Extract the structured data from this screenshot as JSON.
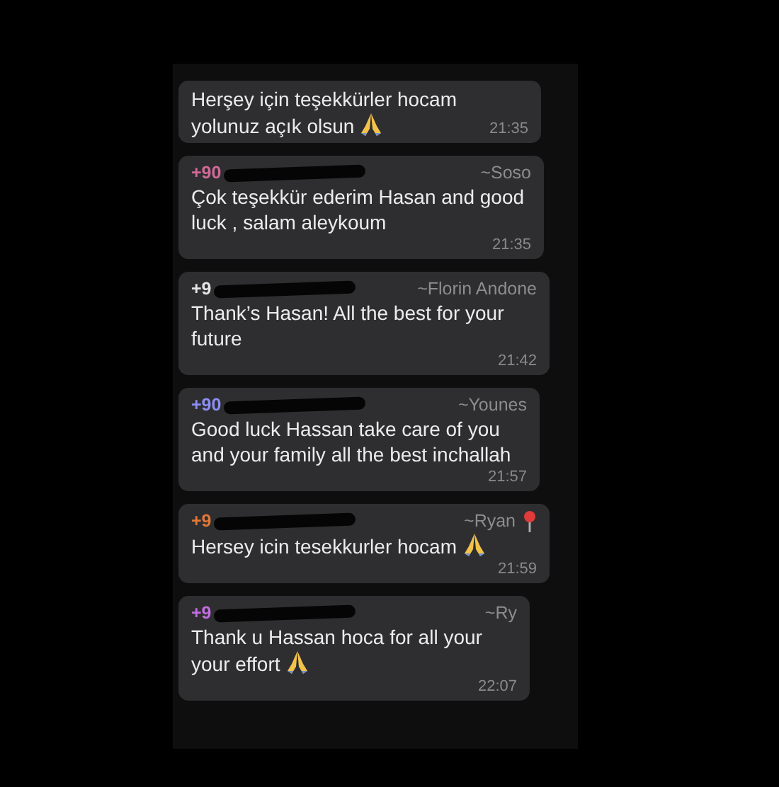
{
  "messages": [
    {
      "text": "Herşey için teşekkürler hocam yolunuz açık olsun",
      "praying_hands": true,
      "time": "21:35"
    },
    {
      "sender_number": "+90",
      "color": "#d06a98",
      "sender_name": "~Soso",
      "text": "Çok teşekkür ederim Hasan and good luck , salam aleykoum",
      "time": "21:35"
    },
    {
      "sender_number": "+9",
      "color": "#e4e4e4",
      "sender_name": "~Florin Andone",
      "text": "Thank’s Hasan! All the best for your future",
      "time": "21:42"
    },
    {
      "sender_number": "+90",
      "color": "#8c8ef2",
      "sender_name": "~Younes",
      "text": "Good luck Hassan take care of you and your family all the best inchallah",
      "time": "21:57"
    },
    {
      "sender_number": "+9",
      "color": "#e07838",
      "sender_name": "~Ryan",
      "text": "Hersey icin tesekkurler hocam",
      "praying_hands": true,
      "pin": true,
      "time": "21:59"
    },
    {
      "sender_number": "+9",
      "color": "#c26ee0",
      "sender_name": "~Ry",
      "text": "Thank u Hassan hoca for all your your effort",
      "praying_hands": true,
      "time": "22:07"
    }
  ]
}
